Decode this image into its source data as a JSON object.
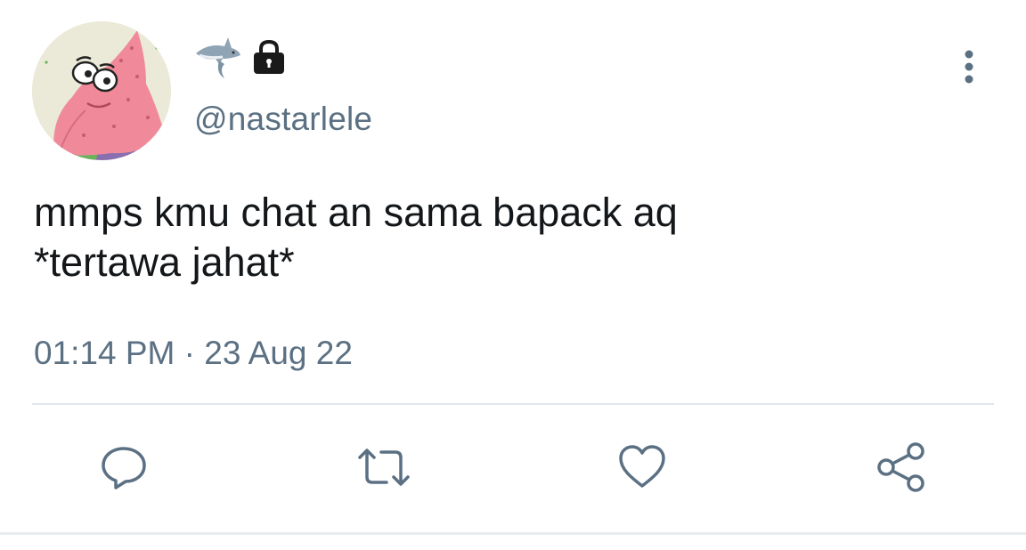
{
  "tweet": {
    "display_name_icons": [
      "shark-emoji",
      "lock-icon"
    ],
    "handle": "@nastarlele",
    "text_lines": [
      "mmps kmu chat an sama bapack aq",
      "*tertawa jahat*"
    ],
    "timestamp": "01:14 PM · 23 Aug 22"
  },
  "actions": [
    {
      "name": "reply-button",
      "icon": "comment-icon"
    },
    {
      "name": "retweet-button",
      "icon": "retweet-icon"
    },
    {
      "name": "like-button",
      "icon": "heart-icon"
    },
    {
      "name": "share-button",
      "icon": "share-icon"
    }
  ],
  "colors": {
    "text": "#14171a",
    "secondary": "#5b7083",
    "icon": "#5b7083",
    "divider": "#e1e8ed"
  }
}
